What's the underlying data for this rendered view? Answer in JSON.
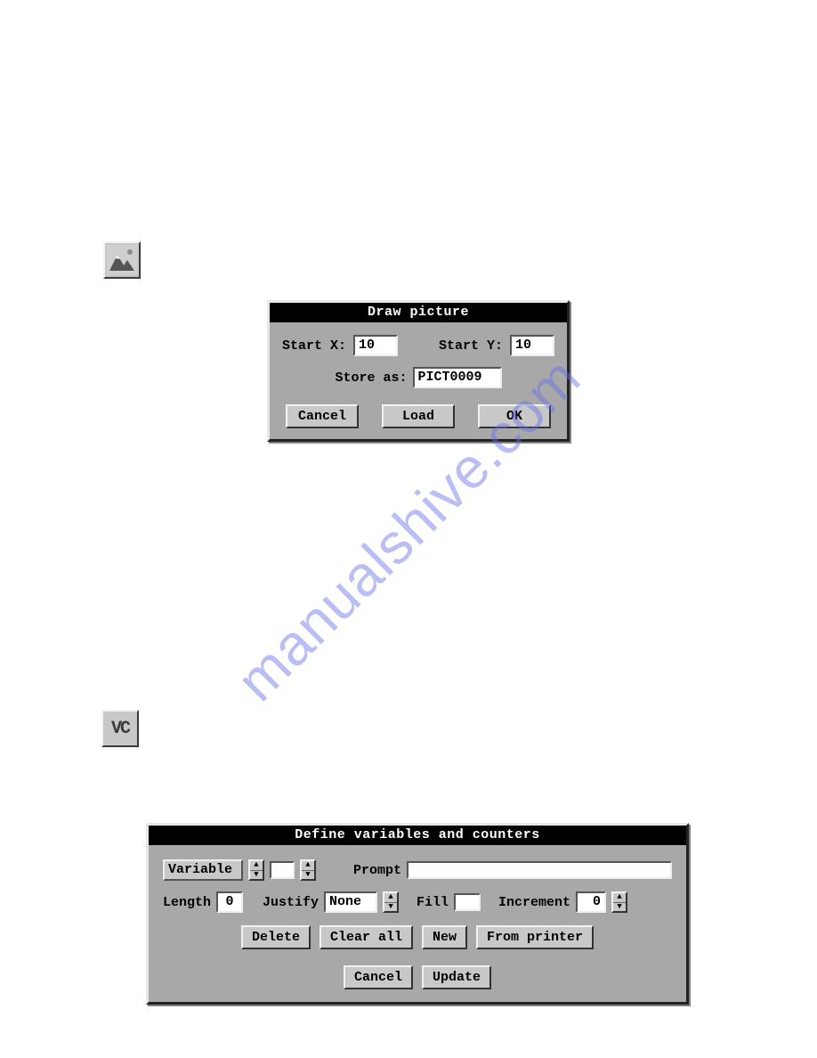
{
  "watermark": "manualshive.com",
  "icons": {
    "picture_tool_name": "picture-tool-icon",
    "vc_tool_label": "VC"
  },
  "dialog1": {
    "title": "Draw picture",
    "startx_label": "Start X:",
    "startx_value": "10",
    "starty_label": "Start Y:",
    "starty_value": "10",
    "storeas_label": "Store as:",
    "storeas_value": "PICT0009",
    "cancel": "Cancel",
    "load": "Load",
    "ok": "OK"
  },
  "dialog2": {
    "title": "Define variables and counters",
    "variable_label": "Variable",
    "variable_index": "",
    "prompt_label": "Prompt",
    "prompt_value": "",
    "length_label": "Length",
    "length_value": "0",
    "justify_label": "Justify",
    "justify_value": "None",
    "fill_label": "Fill",
    "fill_value": "",
    "increment_label": "Increment",
    "increment_value": "0",
    "delete": "Delete",
    "clearall": "Clear all",
    "new": "New",
    "fromprinter": "From printer",
    "cancel": "Cancel",
    "update": "Update"
  }
}
